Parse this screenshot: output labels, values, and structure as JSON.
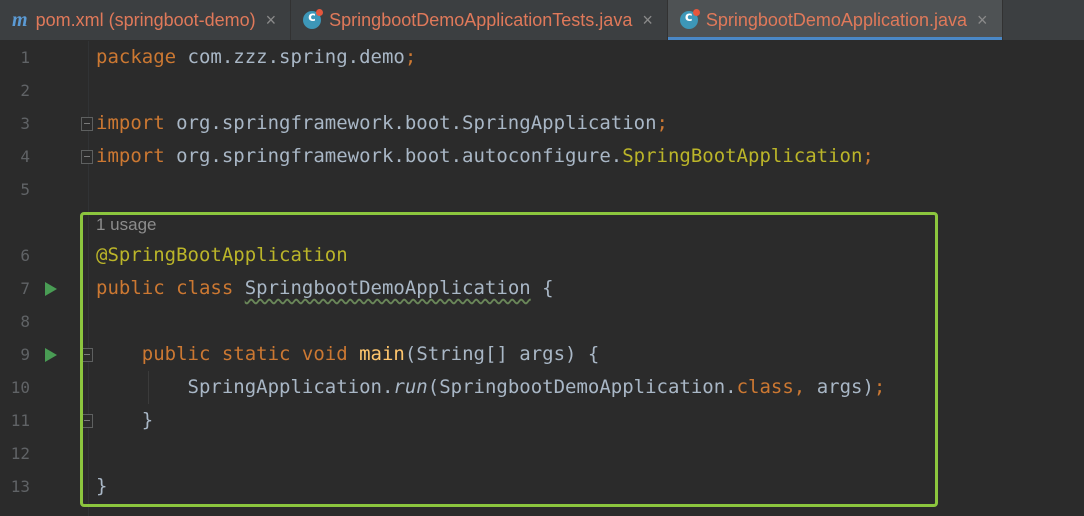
{
  "tabs": [
    {
      "icon": "maven-icon",
      "icon_text": "m",
      "label": "pom.xml (springboot-demo)",
      "close": "×",
      "active": false
    },
    {
      "icon": "java-class-icon",
      "label": "SpringbootDemoApplicationTests.java",
      "close": "×",
      "active": false
    },
    {
      "icon": "java-class-icon",
      "label": "SpringbootDemoApplication.java",
      "close": "×",
      "active": true
    }
  ],
  "colors": {
    "accent": "#4a88c7",
    "highlight_box": "#8cc63e",
    "tab_text": "#e0795a",
    "run_icon": "#499c54"
  },
  "code": {
    "usage_hint": "1 usage",
    "lines": [
      {
        "num": "1",
        "parts": [
          [
            "kw",
            "package"
          ],
          [
            "t",
            " com.zzz.spring.demo"
          ],
          [
            "kw",
            ";"
          ]
        ]
      },
      {
        "num": "2",
        "parts": []
      },
      {
        "num": "3",
        "parts": [
          [
            "kw",
            "import"
          ],
          [
            "t",
            " org.springframework.boot.SpringApplication"
          ],
          [
            "kw",
            ";"
          ]
        ]
      },
      {
        "num": "4",
        "parts": [
          [
            "kw",
            "import"
          ],
          [
            "t",
            " org.springframework.boot.autoconfigure."
          ],
          [
            "ann",
            "SpringBootApplication"
          ],
          [
            "kw",
            ";"
          ]
        ]
      },
      {
        "num": "5",
        "parts": []
      },
      {
        "num": "6",
        "parts": [
          [
            "ann",
            "@SpringBootApplication"
          ]
        ]
      },
      {
        "num": "7",
        "parts": [
          [
            "kw",
            "public class "
          ],
          [
            "wavy",
            "SpringbootDemoApplication"
          ],
          [
            "t",
            " {"
          ]
        ]
      },
      {
        "num": "8",
        "parts": []
      },
      {
        "num": "9",
        "parts": [
          [
            "t",
            "    "
          ],
          [
            "kw",
            "public static void "
          ],
          [
            "fn",
            "main"
          ],
          [
            "t",
            "(String[] args) {"
          ]
        ]
      },
      {
        "num": "10",
        "parts": [
          [
            "t",
            "        SpringApplication."
          ],
          [
            "it",
            "run"
          ],
          [
            "t",
            "(SpringbootDemoApplication."
          ],
          [
            "kw",
            "class, "
          ],
          [
            "t",
            "args)"
          ],
          [
            "kw",
            ";"
          ]
        ]
      },
      {
        "num": "11",
        "parts": [
          [
            "t",
            "    }"
          ]
        ]
      },
      {
        "num": "12",
        "parts": []
      },
      {
        "num": "13",
        "parts": [
          [
            "t",
            "}"
          ]
        ]
      }
    ]
  }
}
